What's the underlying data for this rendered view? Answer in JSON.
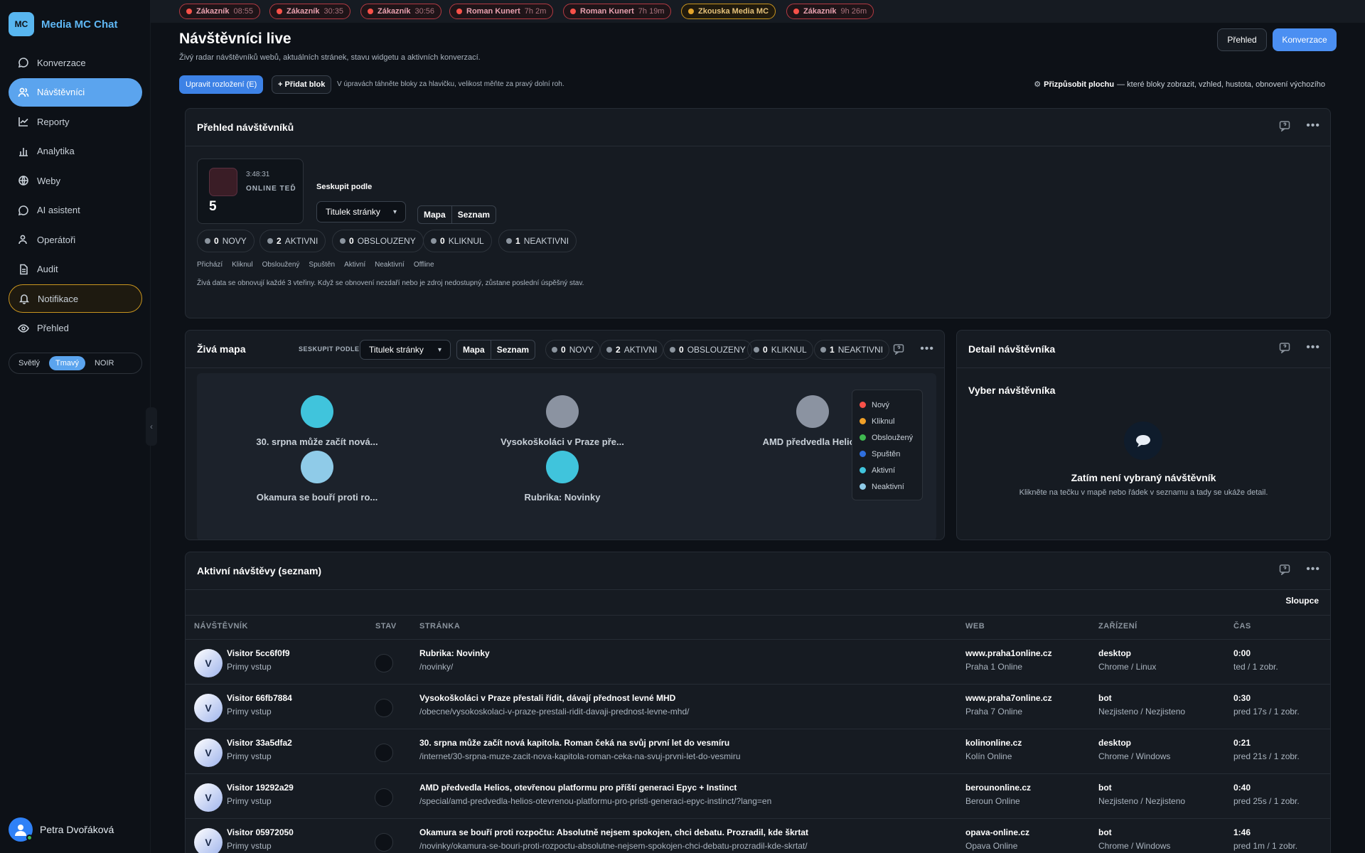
{
  "brand": {
    "logo": "MC",
    "name": "Media MC Chat"
  },
  "nav": [
    {
      "label": "Konverzace",
      "icon": "chat-icon"
    },
    {
      "label": "Návštěvníci",
      "icon": "users-icon",
      "active": true
    },
    {
      "label": "Reporty",
      "icon": "chart-line-icon"
    },
    {
      "label": "Analytika",
      "icon": "bar-chart-icon"
    },
    {
      "label": "Weby",
      "icon": "globe-icon"
    },
    {
      "label": "AI asistent",
      "icon": "chat-icon"
    },
    {
      "label": "Operátoři",
      "icon": "user-icon"
    },
    {
      "label": "Audit",
      "icon": "document-icon"
    },
    {
      "label": "Notifikace",
      "icon": "bell-icon"
    },
    {
      "label": "Přehled",
      "icon": "eye-icon"
    }
  ],
  "theme": {
    "options": [
      "Světlý",
      "Tmavý",
      "NOIR"
    ],
    "selected": "Tmavý"
  },
  "user": {
    "name": "Petra Dvořáková",
    "status": "online"
  },
  "chips": [
    {
      "name": "Zákazník",
      "time": "08:55",
      "color": "#f85149"
    },
    {
      "name": "Zákazník",
      "time": "30:35",
      "color": "#f85149"
    },
    {
      "name": "Zákazník",
      "time": "30:56",
      "color": "#f85149"
    },
    {
      "name": "Roman Kunert",
      "time": "7h 2m",
      "color": "#f85149"
    },
    {
      "name": "Roman Kunert",
      "time": "7h 19m",
      "color": "#f85149"
    },
    {
      "name": "Zkouska Media MC",
      "time": "",
      "color": "#e3a42b"
    },
    {
      "name": "Zákazník",
      "time": "9h 26m",
      "color": "#f85149"
    }
  ],
  "header": {
    "title": "Návštěvníci live",
    "subtitle": "Živý radar návštěvníků webů, aktuálních stránek, stavu widgetu a aktivních konverzací.",
    "overview_btn": "Přehled",
    "conversation_btn": "Konverzace",
    "edit_btn": "Upravit rozložení (E)",
    "add_btn": "+ Přidat blok",
    "edit_hint": "V úpravách táhněte bloky za hlavičku, velikost měňte za pravý dolní roh.",
    "customize_label": "Přizpůsobit plochu",
    "customize_hint": "— které bloky zobrazit, vzhled, hustota, obnovení výchozího"
  },
  "overview": {
    "title": "Přehled návštěvníků",
    "time": "3:48:31",
    "online_label": "ONLINE TEĎ",
    "online_count": "5",
    "group_label": "Seskupit podle",
    "group_select": "Titulek stránky",
    "view_map": "Mapa",
    "view_list": "Seznam",
    "counters": [
      {
        "count": "0",
        "label": "NOVY"
      },
      {
        "count": "2",
        "label": "AKTIVNI"
      },
      {
        "count": "0",
        "label": "OBSLOUZENY"
      },
      {
        "count": "0",
        "label": "KLIKNUL"
      },
      {
        "count": "1",
        "label": "NEAKTIVNI"
      }
    ],
    "statuses": [
      "Přichází",
      "Kliknul",
      "Obsloužený",
      "Spuštěn",
      "Aktivní",
      "Neaktivní",
      "Offline"
    ],
    "refresh_note": "Živá data se obnovují každé 3 vteřiny. Když se obnovení nezdaří nebo je zdroj nedostupný, zůstane poslední úspěšný stav."
  },
  "live_map": {
    "title": "Živá mapa",
    "group_label": "SESKUPIT PODLE",
    "group_select": "Titulek stránky",
    "view_map": "Mapa",
    "view_list": "Seznam",
    "bubbles": [
      {
        "label": "30. srpna může začít nová...",
        "color": "#40c4dc"
      },
      {
        "label": "Vysokoškoláci v Praze pře...",
        "color": "#8b93a1"
      },
      {
        "label": "AMD předvedla Helios,",
        "color": "#8b93a1"
      },
      {
        "label": "Okamura se bouří proti ro...",
        "color": "#8fcbe8"
      },
      {
        "label": "Rubrika: Novinky",
        "color": "#40c4dc"
      }
    ],
    "legend": [
      {
        "label": "Nový",
        "color": "#f85149"
      },
      {
        "label": "Kliknul",
        "color": "#f0a028"
      },
      {
        "label": "Obsloužený",
        "color": "#3fb950"
      },
      {
        "label": "Spuštěn",
        "color": "#2f6fde"
      },
      {
        "label": "Aktivní",
        "color": "#40c4dc"
      },
      {
        "label": "Neaktivní",
        "color": "#8fcbe8"
      }
    ]
  },
  "detail": {
    "title": "Detail návštěvníka",
    "subtitle": "Vyber návštěvníka",
    "empty_title": "Zatím není vybraný návštěvník",
    "empty_hint": "Klikněte na tečku v mapě nebo řádek v seznamu a tady se ukáže detail."
  },
  "visits": {
    "title": "Aktivní návštěvy (seznam)",
    "columns_btn": "Sloupce",
    "headers": [
      "NÁVŠTĚVNÍK",
      "STAV",
      "STRÁNKA",
      "WEB",
      "ZAŘÍZENÍ",
      "ČAS"
    ],
    "rows": [
      {
        "avatar": "V",
        "visitor": "Visitor 5cc6f0f9",
        "source": "Primy vstup",
        "page": "Rubrika: Novinky",
        "path": "/novinky/",
        "web": "www.praha1online.cz",
        "web_name": "Praha 1 Online",
        "device": "desktop",
        "browser": "Chrome / Linux",
        "time": "0:00",
        "ago": "ted / 1 zobr."
      },
      {
        "avatar": "V",
        "visitor": "Visitor 66fb7884",
        "source": "Primy vstup",
        "page": "Vysokoškoláci v Praze přestali řídit, dávají přednost levné MHD",
        "path": "/obecne/vysokoskolaci-v-praze-prestali-ridit-davaji-prednost-levne-mhd/",
        "web": "www.praha7online.cz",
        "web_name": "Praha 7 Online",
        "device": "bot",
        "browser": "Nezjisteno / Nezjisteno",
        "time": "0:30",
        "ago": "pred 17s / 1 zobr."
      },
      {
        "avatar": "V",
        "visitor": "Visitor 33a5dfa2",
        "source": "Primy vstup",
        "page": "30. srpna může začít nová kapitola. Roman čeká na svůj první let do vesmíru",
        "path": "/internet/30-srpna-muze-zacit-nova-kapitola-roman-ceka-na-svuj-prvni-let-do-vesmiru",
        "web": "kolinonline.cz",
        "web_name": "Kolín Online",
        "device": "desktop",
        "browser": "Chrome / Windows",
        "time": "0:21",
        "ago": "pred 21s / 1 zobr."
      },
      {
        "avatar": "V",
        "visitor": "Visitor 19292a29",
        "source": "Primy vstup",
        "page": "AMD předvedla Helios, otevřenou platformu pro příští generaci Epyc + Instinct",
        "path": "/special/amd-predvedla-helios-otevrenou-platformu-pro-pristi-generaci-epyc-instinct/?lang=en",
        "web": "berounonline.cz",
        "web_name": "Beroun Online",
        "device": "bot",
        "browser": "Nezjisteno / Nezjisteno",
        "time": "0:40",
        "ago": "pred 25s / 1 zobr."
      },
      {
        "avatar": "V",
        "visitor": "Visitor 05972050",
        "source": "Primy vstup",
        "page": "Okamura se bouří proti rozpočtu: Absolutně nejsem spokojen, chci debatu. Prozradil, kde škrtat",
        "path": "/novinky/okamura-se-bouri-proti-rozpoctu-absolutne-nejsem-spokojen-chci-debatu-prozradil-kde-skrtat/",
        "web": "opava-online.cz",
        "web_name": "Opava Online",
        "device": "bot",
        "browser": "Chrome / Windows",
        "time": "1:46",
        "ago": "pred 1m / 1 zobr."
      }
    ]
  }
}
